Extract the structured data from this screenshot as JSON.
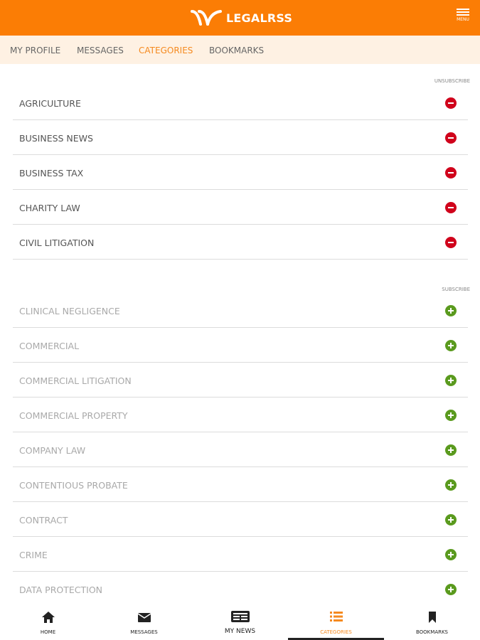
{
  "header": {
    "logo_text": "LEGALRSS",
    "menu_label": "MENU",
    "brand_color": "#fb7d05"
  },
  "subnav": {
    "items": [
      {
        "label": "MY PROFILE",
        "active": false
      },
      {
        "label": "MESSAGES",
        "active": false
      },
      {
        "label": "CATEGORIES",
        "active": true
      },
      {
        "label": "BOOKMARKS",
        "active": false
      }
    ]
  },
  "subscribed": {
    "header": "UNSUBSCRIBE",
    "items": [
      "AGRICULTURE",
      "BUSINESS NEWS",
      "BUSINESS TAX",
      "CHARITY LAW",
      "CIVIL LITIGATION"
    ],
    "icon": "minus-circle-icon",
    "icon_color": "#d0021b"
  },
  "available": {
    "header": "SUBSCRIBE",
    "items": [
      "CLINICAL NEGLIGENCE",
      "COMMERCIAL",
      "COMMERCIAL LITIGATION",
      "COMMERCIAL PROPERTY",
      "COMPANY LAW",
      "CONTENTIOUS PROBATE",
      "CONTRACT",
      "CRIME",
      "DATA PROTECTION"
    ],
    "icon": "plus-circle-icon",
    "icon_color": "#5a9a1e"
  },
  "bottom_nav": {
    "tabs": [
      {
        "label": "HOME",
        "icon": "home-icon",
        "active": false
      },
      {
        "label": "MESSAGES",
        "icon": "envelope-icon",
        "active": false
      },
      {
        "label": "MY NEWS",
        "icon": "newspaper-icon",
        "active": false
      },
      {
        "label": "CATEGORIES",
        "icon": "list-icon",
        "active": true
      },
      {
        "label": "BOOKMARKS",
        "icon": "bookmark-icon",
        "active": false
      }
    ]
  }
}
